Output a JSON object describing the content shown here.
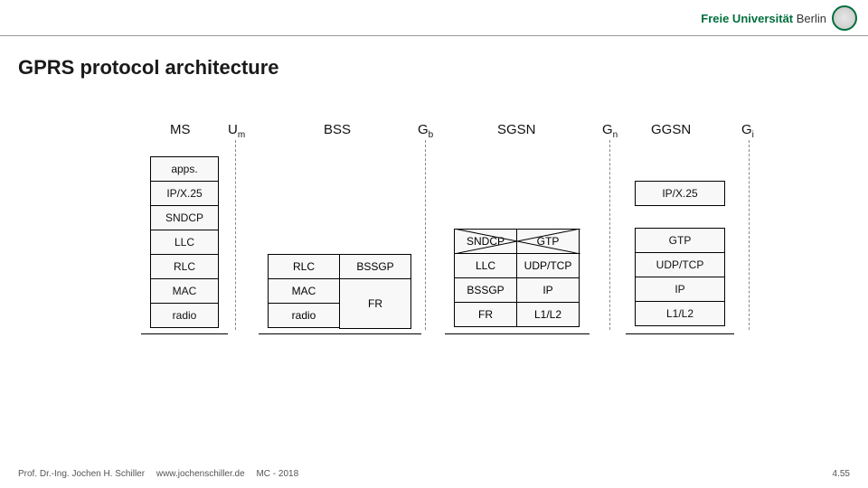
{
  "brand": {
    "uni_left": "Freie Universität",
    "uni_right": "Berlin"
  },
  "title": "GPRS protocol architecture",
  "nodes": {
    "ms": "MS",
    "bss": "BSS",
    "sgsn": "SGSN",
    "ggsn": "GGSN"
  },
  "ifaces": {
    "um_base": "U",
    "um_sub": "m",
    "gb_base": "G",
    "gb_sub": "b",
    "gn_base": "G",
    "gn_sub": "n",
    "gi_base": "G",
    "gi_sub": "i"
  },
  "ms_stack": [
    "apps.",
    "IP/X.25",
    "SNDCP",
    "LLC",
    "RLC",
    "MAC",
    "radio"
  ],
  "bss_left": {
    "rlc": "RLC",
    "mac": "MAC",
    "radio": "radio"
  },
  "bss_right": {
    "bssgp": "BSSGP",
    "fr": "FR"
  },
  "sgsn_left": {
    "sndcp": "SNDCP",
    "llc": "LLC",
    "bssgp": "BSSGP",
    "fr": "FR"
  },
  "sgsn_right": {
    "gtp": "GTP",
    "udptcp": "UDP/TCP",
    "ip": "IP",
    "l1l2": "L1/L2"
  },
  "ggsn_stack": [
    "IP/X.25",
    "GTP",
    "UDP/TCP",
    "IP",
    "L1/L2"
  ],
  "footer": {
    "author": "Prof. Dr.-Ing. Jochen H. Schiller",
    "site": "www.jochenschiller.de",
    "course": "MC - 2018",
    "page": "4.55"
  }
}
